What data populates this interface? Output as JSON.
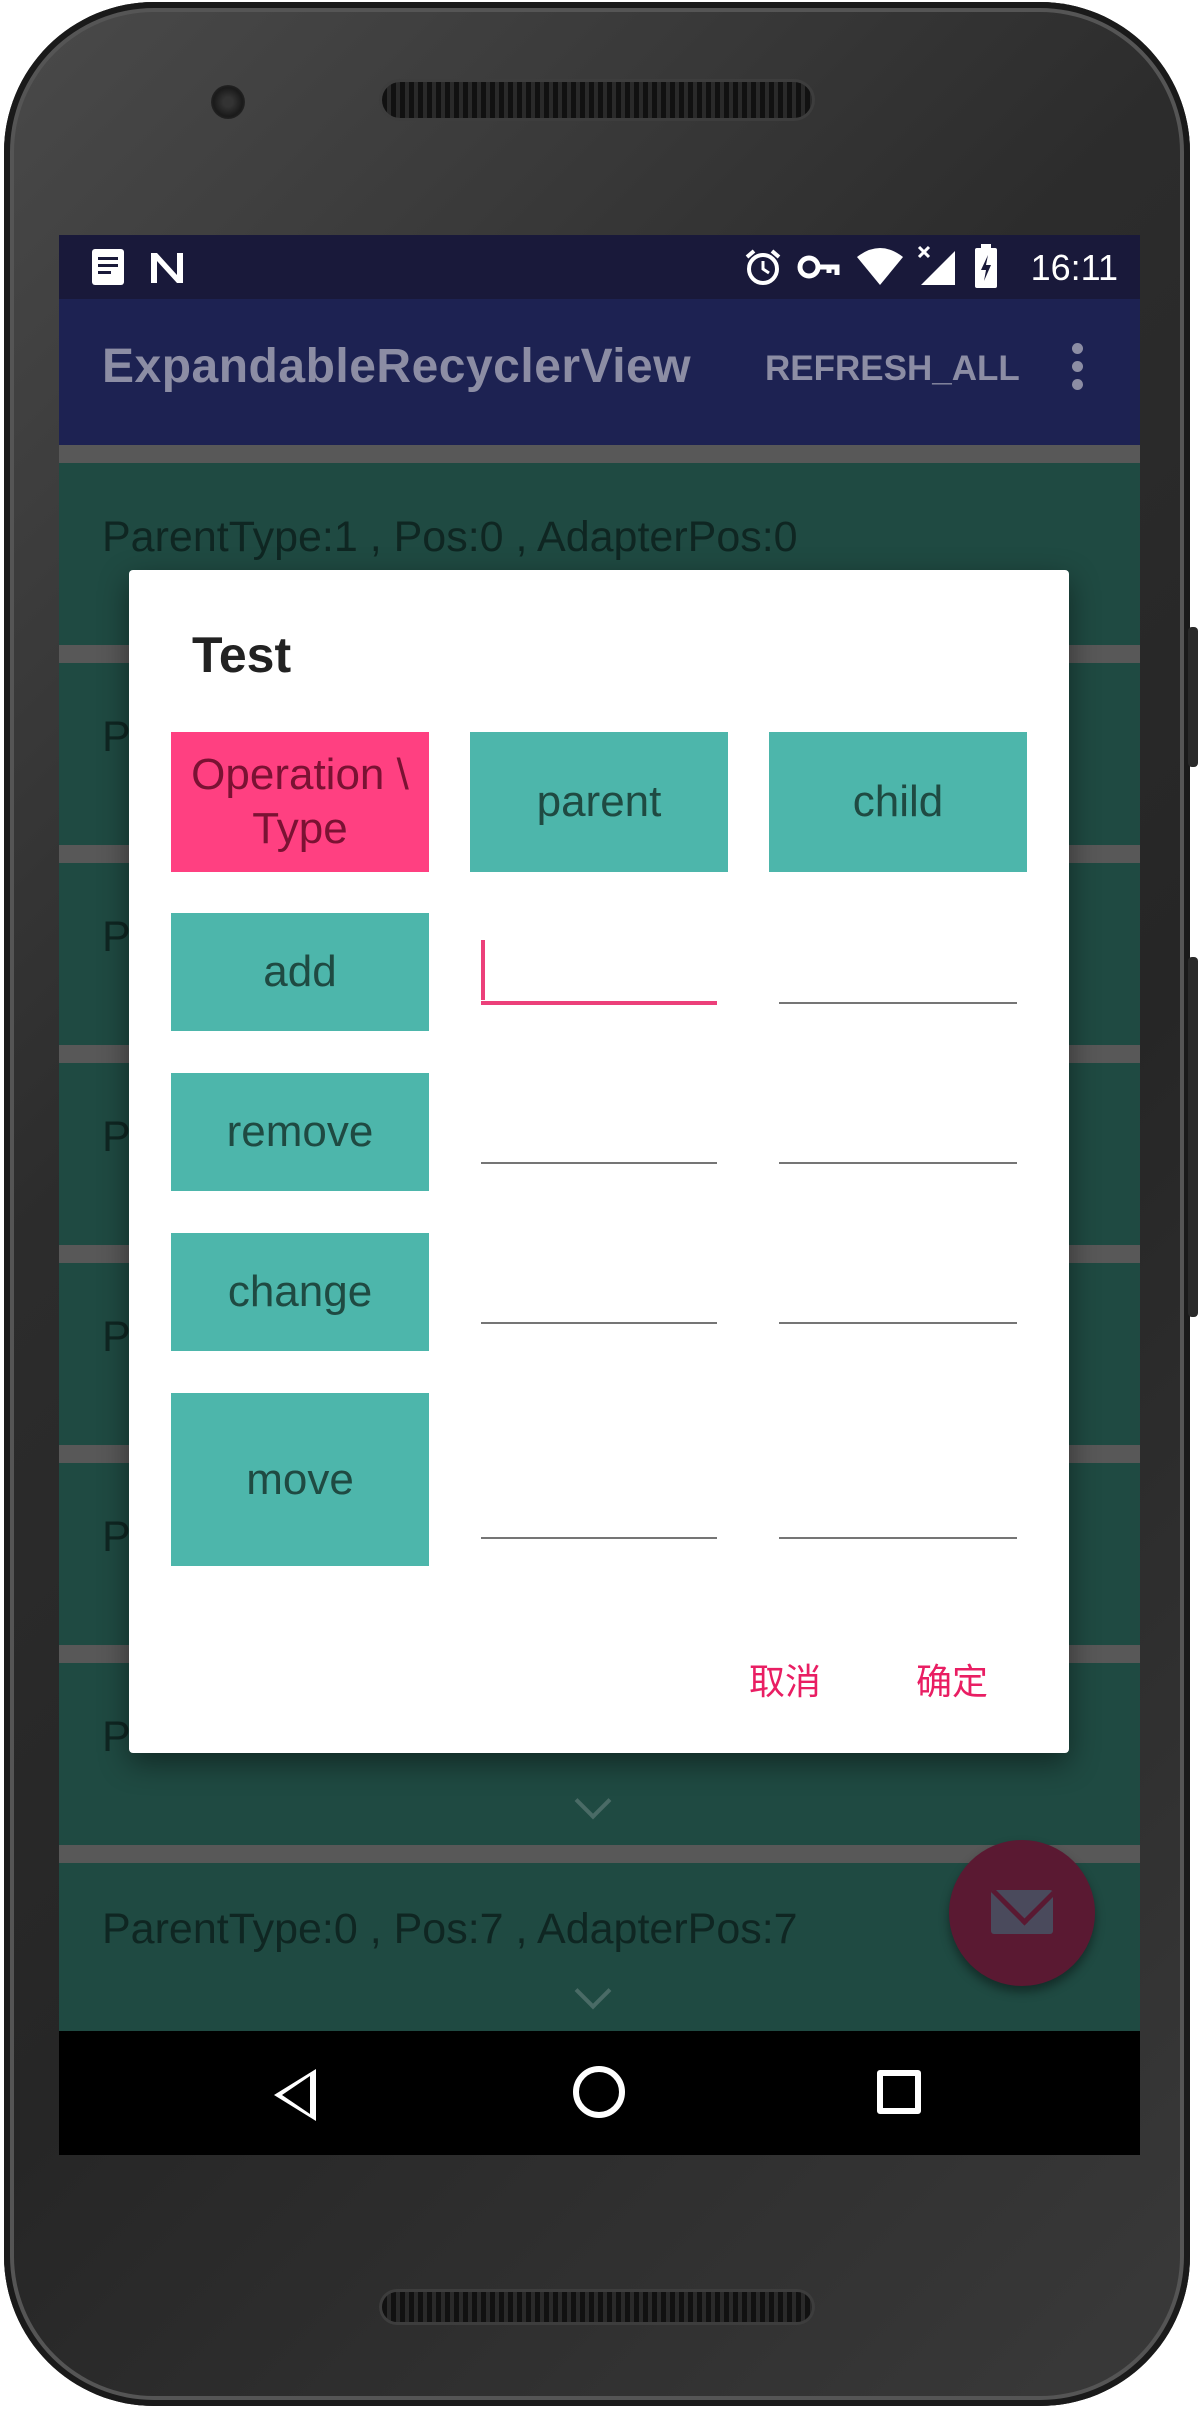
{
  "status_bar": {
    "time": "16:11",
    "left_icons": [
      "notes-icon",
      "n-icon"
    ],
    "right_icons": [
      "alarm-icon",
      "vpn-key-icon",
      "wifi-icon",
      "signal-icon",
      "battery-icon"
    ]
  },
  "app_bar": {
    "title": "ExpandableRecyclerView",
    "action_label": "REFRESH_ALL",
    "overflow_icon": "more-vert-icon"
  },
  "list": {
    "items": [
      {
        "label": "ParentType:1 , Pos:0 , AdapterPos:0"
      },
      {
        "label": "P"
      },
      {
        "label": "P"
      },
      {
        "label": "P"
      },
      {
        "label": "P"
      },
      {
        "label": "P"
      },
      {
        "label": "P"
      },
      {
        "label": "ParentType:0 , Pos:7 , AdapterPos:7"
      }
    ]
  },
  "dialog": {
    "title": "Test",
    "header": {
      "corner": "Operation \\ Type",
      "col_parent": "parent",
      "col_child": "child"
    },
    "rows": [
      {
        "op": "add",
        "parent_value": "",
        "child_value": ""
      },
      {
        "op": "remove",
        "parent_value": "",
        "child_value": ""
      },
      {
        "op": "change",
        "parent_value": "",
        "child_value": ""
      },
      {
        "op": "move",
        "parent_value": "",
        "child_value": ""
      }
    ],
    "cancel_label": "取消",
    "confirm_label": "确定"
  },
  "fab": {
    "icon": "email-icon"
  },
  "nav_bar": {
    "icons": [
      "back-icon",
      "home-icon",
      "recents-icon"
    ]
  },
  "colors": {
    "primary": "#1d2252",
    "list_bg": "#1f4a42",
    "teal_button": "#4db6ab",
    "accent": "#ff4081",
    "dialog_action": "#e91e63"
  }
}
